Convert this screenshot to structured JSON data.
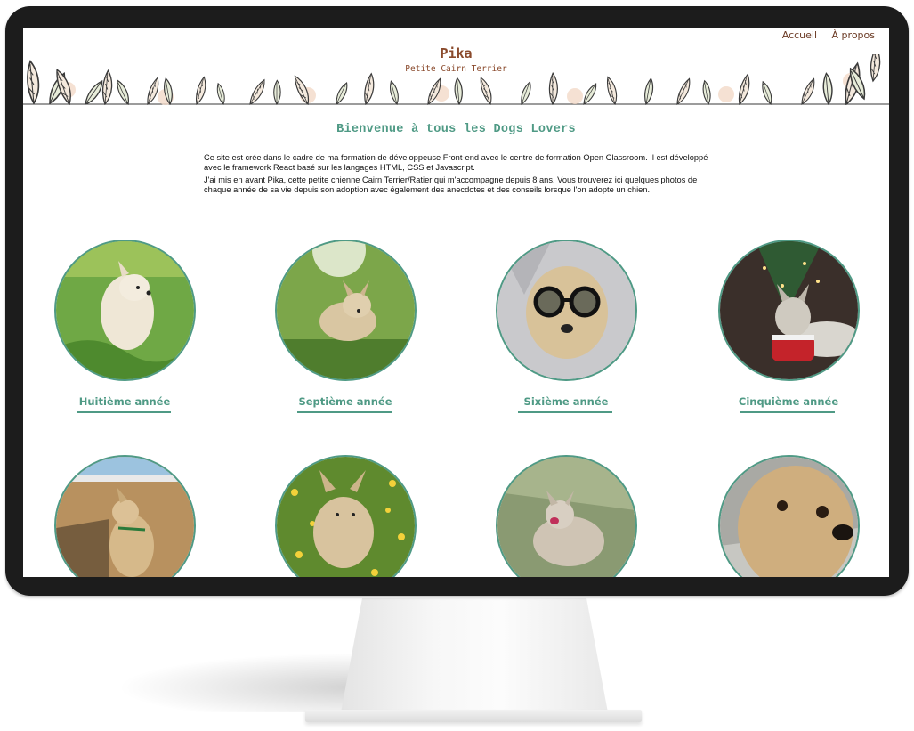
{
  "nav": {
    "home": "Accueil",
    "about": "À propos"
  },
  "header": {
    "title": "Pika",
    "subtitle": "Petite Cairn Terrier"
  },
  "main": {
    "welcome": "Bienvenue à tous les Dogs Lovers",
    "intro": [
      "Ce site est crée dans le cadre de ma formation de développeuse Front-end avec le centre de formation Open Classroom. Il est développé avec le framework React basé sur les langages HTML, CSS et Javascript.",
      "J'ai mis en avant Pika, cette petite chienne Cairn Terrier/Ratier qui m'accompagne depuis 8 ans. Vous trouverez ici quelques photos de chaque année de sa vie depuis son adoption avec également des anecdotes et des conseils lorsque l'on adopte un chien."
    ]
  },
  "cards": [
    {
      "label": "Huitième année"
    },
    {
      "label": "Septième année"
    },
    {
      "label": "Sixième année"
    },
    {
      "label": "Cinquième année"
    },
    {
      "label": ""
    },
    {
      "label": ""
    },
    {
      "label": ""
    },
    {
      "label": ""
    }
  ],
  "colors": {
    "accent": "#4f9a85",
    "brand": "#8a4a2c",
    "frame": "#1c1c1c"
  }
}
